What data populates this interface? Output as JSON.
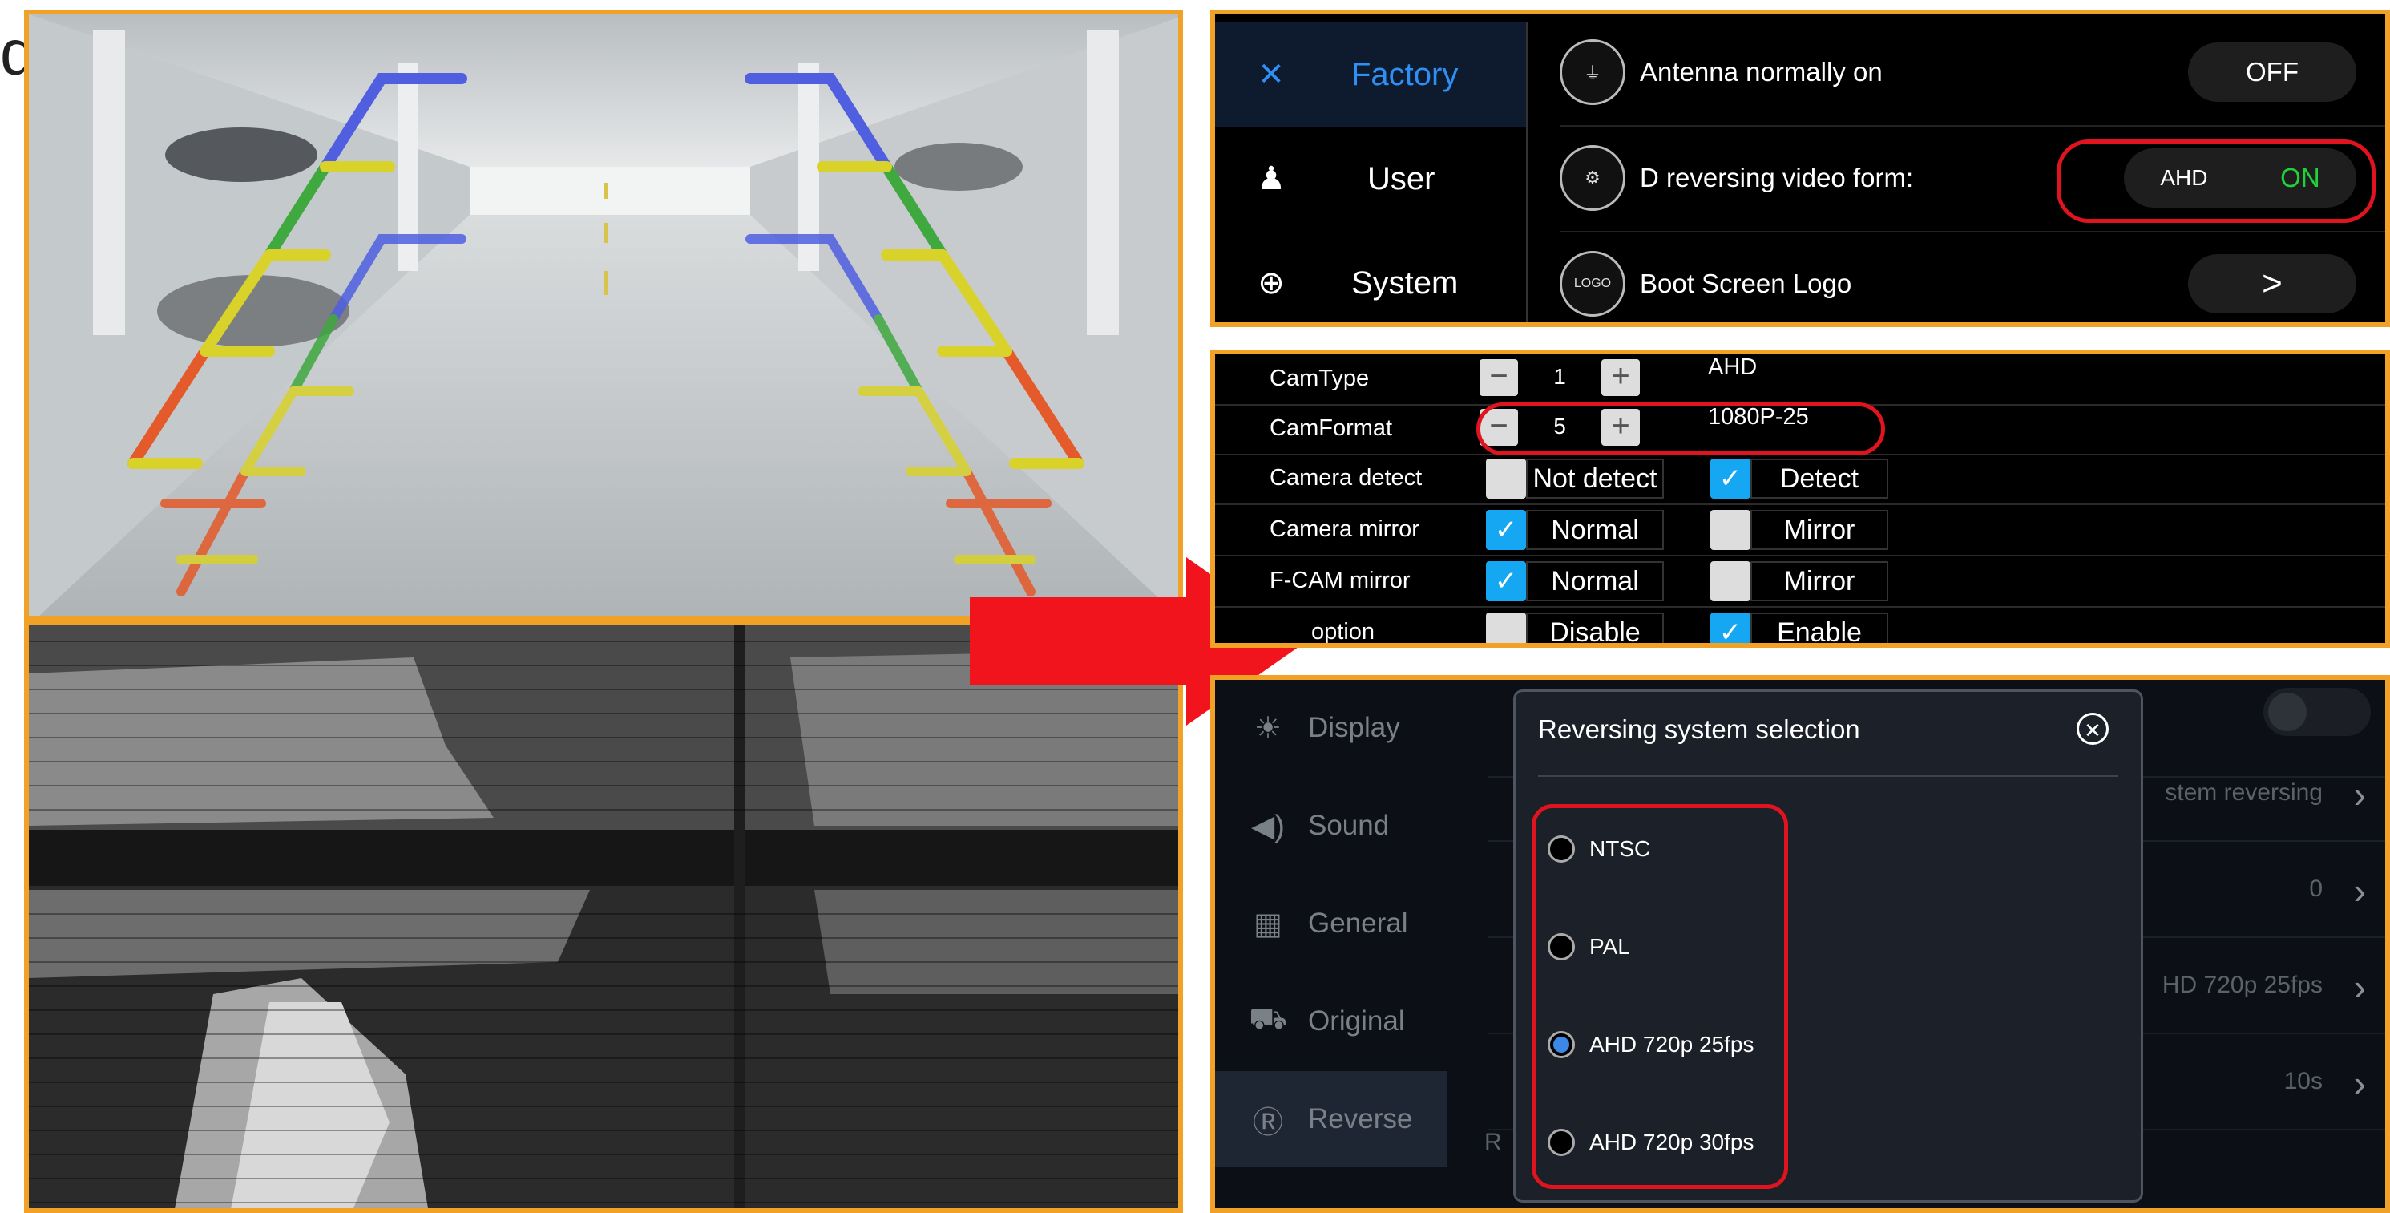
{
  "left_letter": "d",
  "factory_panel": {
    "sidebar": [
      {
        "label": "Factory",
        "icon": "tools-icon",
        "active": true
      },
      {
        "label": "User",
        "icon": "user-icon",
        "active": false
      },
      {
        "label": "System",
        "icon": "globe-icon",
        "active": false
      }
    ],
    "settings": [
      {
        "label": "Antenna normally on",
        "icon": "antenna-icon",
        "value": "OFF"
      },
      {
        "label": "D reversing video form:",
        "icon": "gear-icon",
        "prefix": "AHD",
        "value": "ON"
      },
      {
        "label": "Boot Screen Logo",
        "icon_text": "LOGO",
        "value": ">"
      }
    ]
  },
  "cam_panel": {
    "camtype": {
      "label": "CamType",
      "value": "1",
      "text": "AHD"
    },
    "camformat": {
      "label": "CamFormat",
      "value": "5",
      "text": "1080P-25"
    },
    "rows": [
      {
        "label": "Camera detect",
        "opt1": "Not detect",
        "opt1_checked": false,
        "opt2": "Detect",
        "opt2_checked": true
      },
      {
        "label": "Camera mirror",
        "opt1": "Normal",
        "opt1_checked": true,
        "opt2": "Mirror",
        "opt2_checked": false
      },
      {
        "label": "F-CAM mirror",
        "opt1": "Normal",
        "opt1_checked": true,
        "opt2": "Mirror",
        "opt2_checked": false
      },
      {
        "label": "option",
        "opt1": "Disable",
        "opt1_checked": false,
        "opt2": "Enable",
        "opt2_checked": true
      }
    ],
    "minus": "−",
    "plus": "+"
  },
  "reverse_panel": {
    "sidebar": [
      {
        "label": "Display",
        "icon": "sun-icon"
      },
      {
        "label": "Sound",
        "icon": "speaker-icon"
      },
      {
        "label": "General",
        "icon": "grid-icon"
      },
      {
        "label": "Original",
        "icon": "car-icon"
      },
      {
        "label": "Reverse",
        "icon": "r-icon",
        "active": true
      }
    ],
    "background_rows": [
      {
        "text": "stem reversing",
        "value": ""
      },
      {
        "text": "",
        "value": "0"
      },
      {
        "text": "HD 720p 25fps",
        "value": ""
      },
      {
        "text": "",
        "value": "10s"
      }
    ],
    "bottom_fragment": "R",
    "dialog": {
      "title": "Reversing system selection",
      "options": [
        {
          "label": "NTSC",
          "selected": false
        },
        {
          "label": "PAL",
          "selected": false
        },
        {
          "label": "AHD 720p 25fps",
          "selected": true
        },
        {
          "label": "AHD 720p 30fps",
          "selected": false
        }
      ]
    }
  },
  "colors": {
    "frame": "#f2a127",
    "highlight": "#e0141f",
    "active_blue": "#2f8ff4",
    "on_green": "#22d13a",
    "check_blue": "#16a7f2"
  }
}
